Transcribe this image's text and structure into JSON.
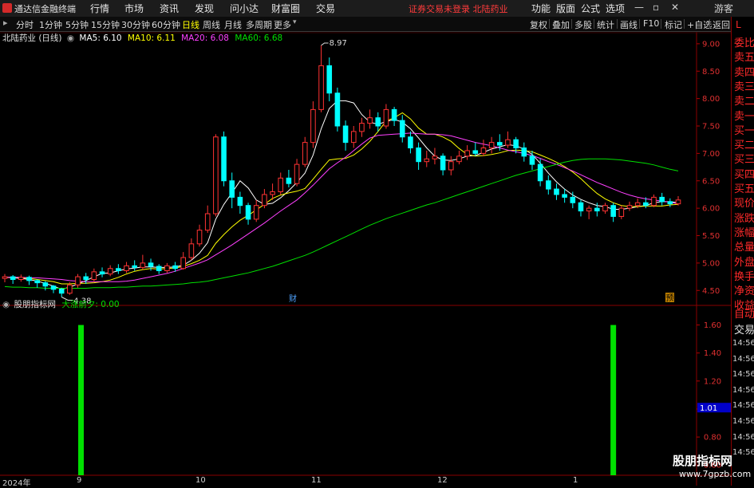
{
  "app": {
    "title": "通达信金融终端"
  },
  "menu": [
    "行情",
    "市场",
    "资讯",
    "发现",
    "问小达",
    "财富圈",
    "交易"
  ],
  "notice": "证券交易未登录  北陆药业",
  "right_menu": [
    "功能",
    "版面",
    "公式",
    "选项"
  ],
  "window_controls": {
    "minimize": "—",
    "restore": "▫",
    "close": "✕",
    "guest": "游客"
  },
  "periods": [
    "分时",
    "1分钟",
    "5分钟",
    "15分钟",
    "30分钟",
    "60分钟",
    "日线",
    "周线",
    "月线",
    "多周期",
    "更多"
  ],
  "active_period": "日线",
  "tools": [
    "复权",
    "叠加",
    "多股",
    "统计",
    "画线",
    "F10",
    "标记",
    "+自选",
    "返回"
  ],
  "stock": {
    "name": "北陆药业 (日线)"
  },
  "ma": [
    {
      "label": "MA5: 6.10",
      "color": "#ffffff"
    },
    {
      "label": "MA10: 6.11",
      "color": "#ffff00"
    },
    {
      "label": "MA20: 6.08",
      "color": "#ff40ff"
    },
    {
      "label": "MA60: 6.68",
      "color": "#00e000"
    }
  ],
  "price_axis": [
    "9.00",
    "8.50",
    "8.00",
    "7.50",
    "7.00",
    "6.50",
    "6.00",
    "5.50",
    "5.00",
    "4.50"
  ],
  "high_marker": "8.97",
  "low_marker": "4.38",
  "event_markers": {
    "fin": "财",
    "forecast": "预"
  },
  "indicator": {
    "name": "股朋指标网",
    "label": "大涨前夕: 0.00",
    "label_color": "#00e000"
  },
  "ind_axis": [
    "1.60",
    "1.40",
    "1.20",
    "1.00",
    "0.80",
    "0.60"
  ],
  "ind_current": "1.01",
  "x_axis": {
    "year": "2024年",
    "months": [
      "9",
      "10",
      "11",
      "12",
      "1"
    ]
  },
  "sidebar": {
    "top": "L",
    "rows": [
      "委比",
      "卖五",
      "卖四",
      "卖三",
      "卖二",
      "卖一",
      "买一",
      "买二",
      "买三",
      "买四",
      "买五",
      "现价",
      "涨跌",
      "涨幅",
      "总量",
      "外盘",
      "换手",
      "净资",
      "收益"
    ],
    "lower": [
      "自动",
      "交易"
    ],
    "times": [
      "14:56",
      "14:56",
      "14:56",
      "14:56",
      "14:56",
      "14:56",
      "14:56",
      "14:56"
    ]
  },
  "watermark": {
    "title": "股朋指标网",
    "url": "www.7gpzb.com"
  },
  "colors": {
    "up": "#ff3333",
    "down": "#00ffff",
    "axis": "#b00000",
    "signal": "#00e000"
  },
  "chart_data": {
    "type": "candlestick",
    "ylim": [
      4.3,
      9.1
    ],
    "candles": [
      [
        4.72,
        4.75,
        4.8,
        4.65
      ],
      [
        4.75,
        4.7,
        4.78,
        4.62
      ],
      [
        4.7,
        4.74,
        4.79,
        4.66
      ],
      [
        4.74,
        4.68,
        4.77,
        4.6
      ],
      [
        4.68,
        4.64,
        4.7,
        4.55
      ],
      [
        4.64,
        4.58,
        4.67,
        4.5
      ],
      [
        4.58,
        4.52,
        4.6,
        4.45
      ],
      [
        4.52,
        4.45,
        4.55,
        4.38
      ],
      [
        4.45,
        4.6,
        4.65,
        4.42
      ],
      [
        4.6,
        4.75,
        4.8,
        4.55
      ],
      [
        4.75,
        4.7,
        4.82,
        4.62
      ],
      [
        4.7,
        4.84,
        4.9,
        4.66
      ],
      [
        4.84,
        4.8,
        4.92,
        4.74
      ],
      [
        4.8,
        4.9,
        4.96,
        4.76
      ],
      [
        4.9,
        4.86,
        4.98,
        4.8
      ],
      [
        4.86,
        4.95,
        5.02,
        4.82
      ],
      [
        4.95,
        4.92,
        5.05,
        4.86
      ],
      [
        4.92,
        5.0,
        5.15,
        4.88
      ],
      [
        5.0,
        4.94,
        5.08,
        4.86
      ],
      [
        4.94,
        4.86,
        4.98,
        4.8
      ],
      [
        4.86,
        4.95,
        5.0,
        4.82
      ],
      [
        4.95,
        4.9,
        5.02,
        4.84
      ],
      [
        4.9,
        5.1,
        5.2,
        4.88
      ],
      [
        5.1,
        5.35,
        5.45,
        5.05
      ],
      [
        5.35,
        5.6,
        5.7,
        5.3
      ],
      [
        5.6,
        5.9,
        6.05,
        5.55
      ],
      [
        5.9,
        7.3,
        7.35,
        5.85
      ],
      [
        7.3,
        6.5,
        7.4,
        6.4
      ],
      [
        6.5,
        6.2,
        6.65,
        6.0
      ],
      [
        6.2,
        6.05,
        6.3,
        5.9
      ],
      [
        6.05,
        5.8,
        6.1,
        5.7
      ],
      [
        5.8,
        6.05,
        6.15,
        5.75
      ],
      [
        6.05,
        6.25,
        6.35,
        6.0
      ],
      [
        6.25,
        6.3,
        6.45,
        6.15
      ],
      [
        6.3,
        6.55,
        6.65,
        6.25
      ],
      [
        6.55,
        6.45,
        6.7,
        6.38
      ],
      [
        6.45,
        6.8,
        6.9,
        6.4
      ],
      [
        6.8,
        7.2,
        7.3,
        6.75
      ],
      [
        7.2,
        7.8,
        7.95,
        7.1
      ],
      [
        7.8,
        8.6,
        8.97,
        7.75
      ],
      [
        8.6,
        8.1,
        8.75,
        7.95
      ],
      [
        8.1,
        7.5,
        8.2,
        7.4
      ],
      [
        7.5,
        7.2,
        7.6,
        7.05
      ],
      [
        7.2,
        7.4,
        7.5,
        7.1
      ],
      [
        7.4,
        7.55,
        7.65,
        7.3
      ],
      [
        7.55,
        7.65,
        7.8,
        7.45
      ],
      [
        7.65,
        7.5,
        7.75,
        7.4
      ],
      [
        7.5,
        7.8,
        7.9,
        7.45
      ],
      [
        7.8,
        7.6,
        7.85,
        7.5
      ],
      [
        7.6,
        7.3,
        7.7,
        7.2
      ],
      [
        7.3,
        7.1,
        7.4,
        7.0
      ],
      [
        7.1,
        6.85,
        7.2,
        6.7
      ],
      [
        6.85,
        6.9,
        7.05,
        6.75
      ],
      [
        6.9,
        6.95,
        7.1,
        6.8
      ],
      [
        6.95,
        6.7,
        7.0,
        6.6
      ],
      [
        6.7,
        6.85,
        6.95,
        6.6
      ],
      [
        6.85,
        6.95,
        7.05,
        6.8
      ],
      [
        6.95,
        7.05,
        7.15,
        6.88
      ],
      [
        7.05,
        7.0,
        7.2,
        6.95
      ],
      [
        7.0,
        7.1,
        7.25,
        6.95
      ],
      [
        7.1,
        7.2,
        7.3,
        7.0
      ],
      [
        7.2,
        7.15,
        7.35,
        7.05
      ],
      [
        7.15,
        7.25,
        7.4,
        7.1
      ],
      [
        7.25,
        7.1,
        7.3,
        7.0
      ],
      [
        7.1,
        6.95,
        7.2,
        6.85
      ],
      [
        6.95,
        6.8,
        7.05,
        6.7
      ],
      [
        6.8,
        6.5,
        6.9,
        6.4
      ],
      [
        6.5,
        6.35,
        6.6,
        6.25
      ],
      [
        6.35,
        6.25,
        6.45,
        6.15
      ],
      [
        6.25,
        6.2,
        6.35,
        6.1
      ],
      [
        6.2,
        6.1,
        6.3,
        6.0
      ],
      [
        6.1,
        5.95,
        6.15,
        5.85
      ],
      [
        5.95,
        6.0,
        6.05,
        5.8
      ],
      [
        6.0,
        5.95,
        6.1,
        5.85
      ],
      [
        5.95,
        6.05,
        6.1,
        5.9
      ],
      [
        6.05,
        5.85,
        6.1,
        5.75
      ],
      [
        5.85,
        6.0,
        6.05,
        5.8
      ],
      [
        6.0,
        6.05,
        6.12,
        5.95
      ],
      [
        6.05,
        6.1,
        6.18,
        6.0
      ],
      [
        6.1,
        6.05,
        6.2,
        6.0
      ],
      [
        6.05,
        6.2,
        6.25,
        6.02
      ],
      [
        6.2,
        6.12,
        6.28,
        6.05
      ],
      [
        6.12,
        6.08,
        6.18,
        6.02
      ],
      [
        6.08,
        6.15,
        6.22,
        6.05
      ]
    ],
    "ma_series": [
      {
        "name": "MA5",
        "color": "#ffffff",
        "values": [
          4.74,
          4.73,
          4.72,
          4.7,
          4.67,
          4.63,
          4.58,
          4.52,
          4.56,
          4.62,
          4.68,
          4.75,
          4.81,
          4.82,
          4.86,
          4.89,
          4.91,
          4.93,
          4.93,
          4.92,
          4.92,
          4.93,
          4.96,
          5.05,
          5.18,
          5.37,
          5.8,
          6.07,
          6.28,
          6.5,
          6.37,
          6.15,
          6.07,
          6.09,
          6.19,
          6.32,
          6.47,
          6.64,
          6.97,
          7.45,
          7.82,
          7.96,
          7.96,
          7.92,
          7.71,
          7.57,
          7.53,
          7.58,
          7.62,
          7.57,
          7.45,
          7.28,
          7.1,
          6.95,
          6.88,
          6.87,
          6.9,
          6.95,
          6.96,
          7.02,
          7.08,
          7.12,
          7.16,
          7.14,
          7.08,
          6.98,
          6.82,
          6.64,
          6.48,
          6.35,
          6.24,
          6.16,
          6.1,
          6.05,
          6.03,
          5.98,
          5.98,
          6.0,
          6.03,
          6.05,
          6.1,
          6.12,
          6.12,
          6.1
        ]
      },
      {
        "name": "MA10",
        "color": "#ffff00",
        "values": [
          4.74,
          4.74,
          4.73,
          4.72,
          4.7,
          4.68,
          4.66,
          4.62,
          4.62,
          4.63,
          4.63,
          4.64,
          4.66,
          4.69,
          4.74,
          4.8,
          4.85,
          4.88,
          4.9,
          4.89,
          4.9,
          4.91,
          4.94,
          4.99,
          5.05,
          5.14,
          5.36,
          5.52,
          5.66,
          5.78,
          5.87,
          5.97,
          6.07,
          6.18,
          6.24,
          6.28,
          6.31,
          6.36,
          6.53,
          6.71,
          6.88,
          6.9,
          6.91,
          6.97,
          7.08,
          7.22,
          7.4,
          7.59,
          7.65,
          7.74,
          7.63,
          7.46,
          7.35,
          7.35,
          7.3,
          7.22,
          7.09,
          6.98,
          6.95,
          6.96,
          6.98,
          7.01,
          7.05,
          7.06,
          7.05,
          7.03,
          6.97,
          6.91,
          6.84,
          6.76,
          6.66,
          6.54,
          6.4,
          6.27,
          6.17,
          6.1,
          6.05,
          6.03,
          6.03,
          6.04,
          6.04,
          6.04,
          6.06,
          6.07
        ]
      },
      {
        "name": "MA20",
        "color": "#ff40ff",
        "values": [
          4.74,
          4.74,
          4.74,
          4.73,
          4.73,
          4.72,
          4.71,
          4.7,
          4.68,
          4.67,
          4.66,
          4.66,
          4.66,
          4.66,
          4.66,
          4.67,
          4.69,
          4.72,
          4.75,
          4.78,
          4.81,
          4.85,
          4.9,
          4.95,
          5.0,
          5.06,
          5.15,
          5.24,
          5.33,
          5.43,
          5.53,
          5.63,
          5.73,
          5.84,
          5.95,
          6.05,
          6.15,
          6.28,
          6.42,
          6.57,
          6.72,
          6.83,
          6.93,
          7.05,
          7.17,
          7.28,
          7.33,
          7.34,
          7.35,
          7.36,
          7.37,
          7.36,
          7.35,
          7.35,
          7.34,
          7.32,
          7.28,
          7.24,
          7.2,
          7.17,
          7.14,
          7.1,
          7.06,
          7.03,
          7.0,
          6.96,
          6.91,
          6.85,
          6.8,
          6.74,
          6.68,
          6.61,
          6.54,
          6.47,
          6.41,
          6.35,
          6.29,
          6.24,
          6.2,
          6.17,
          6.15,
          6.13,
          6.11,
          6.08
        ]
      },
      {
        "name": "MA60",
        "color": "#00e000",
        "values": [
          4.57,
          4.56,
          4.56,
          4.55,
          4.55,
          4.54,
          4.54,
          4.54,
          4.54,
          4.54,
          4.54,
          4.55,
          4.55,
          4.55,
          4.56,
          4.56,
          4.57,
          4.58,
          4.58,
          4.59,
          4.6,
          4.61,
          4.62,
          4.64,
          4.65,
          4.67,
          4.7,
          4.73,
          4.76,
          4.79,
          4.82,
          4.86,
          4.9,
          4.94,
          4.99,
          5.04,
          5.09,
          5.14,
          5.2,
          5.27,
          5.34,
          5.41,
          5.48,
          5.55,
          5.62,
          5.69,
          5.75,
          5.81,
          5.86,
          5.91,
          5.96,
          6.01,
          6.06,
          6.1,
          6.15,
          6.2,
          6.25,
          6.3,
          6.35,
          6.4,
          6.45,
          6.5,
          6.55,
          6.6,
          6.64,
          6.68,
          6.72,
          6.76,
          6.8,
          6.84,
          6.87,
          6.89,
          6.9,
          6.9,
          6.9,
          6.89,
          6.88,
          6.86,
          6.84,
          6.82,
          6.79,
          6.75,
          6.71,
          6.68
        ]
      }
    ],
    "indicator_series": {
      "name": "大涨前夕",
      "signals_at": [
        9,
        75
      ],
      "signal_value": 1.6,
      "ylim": [
        0.55,
        1.7
      ]
    }
  }
}
